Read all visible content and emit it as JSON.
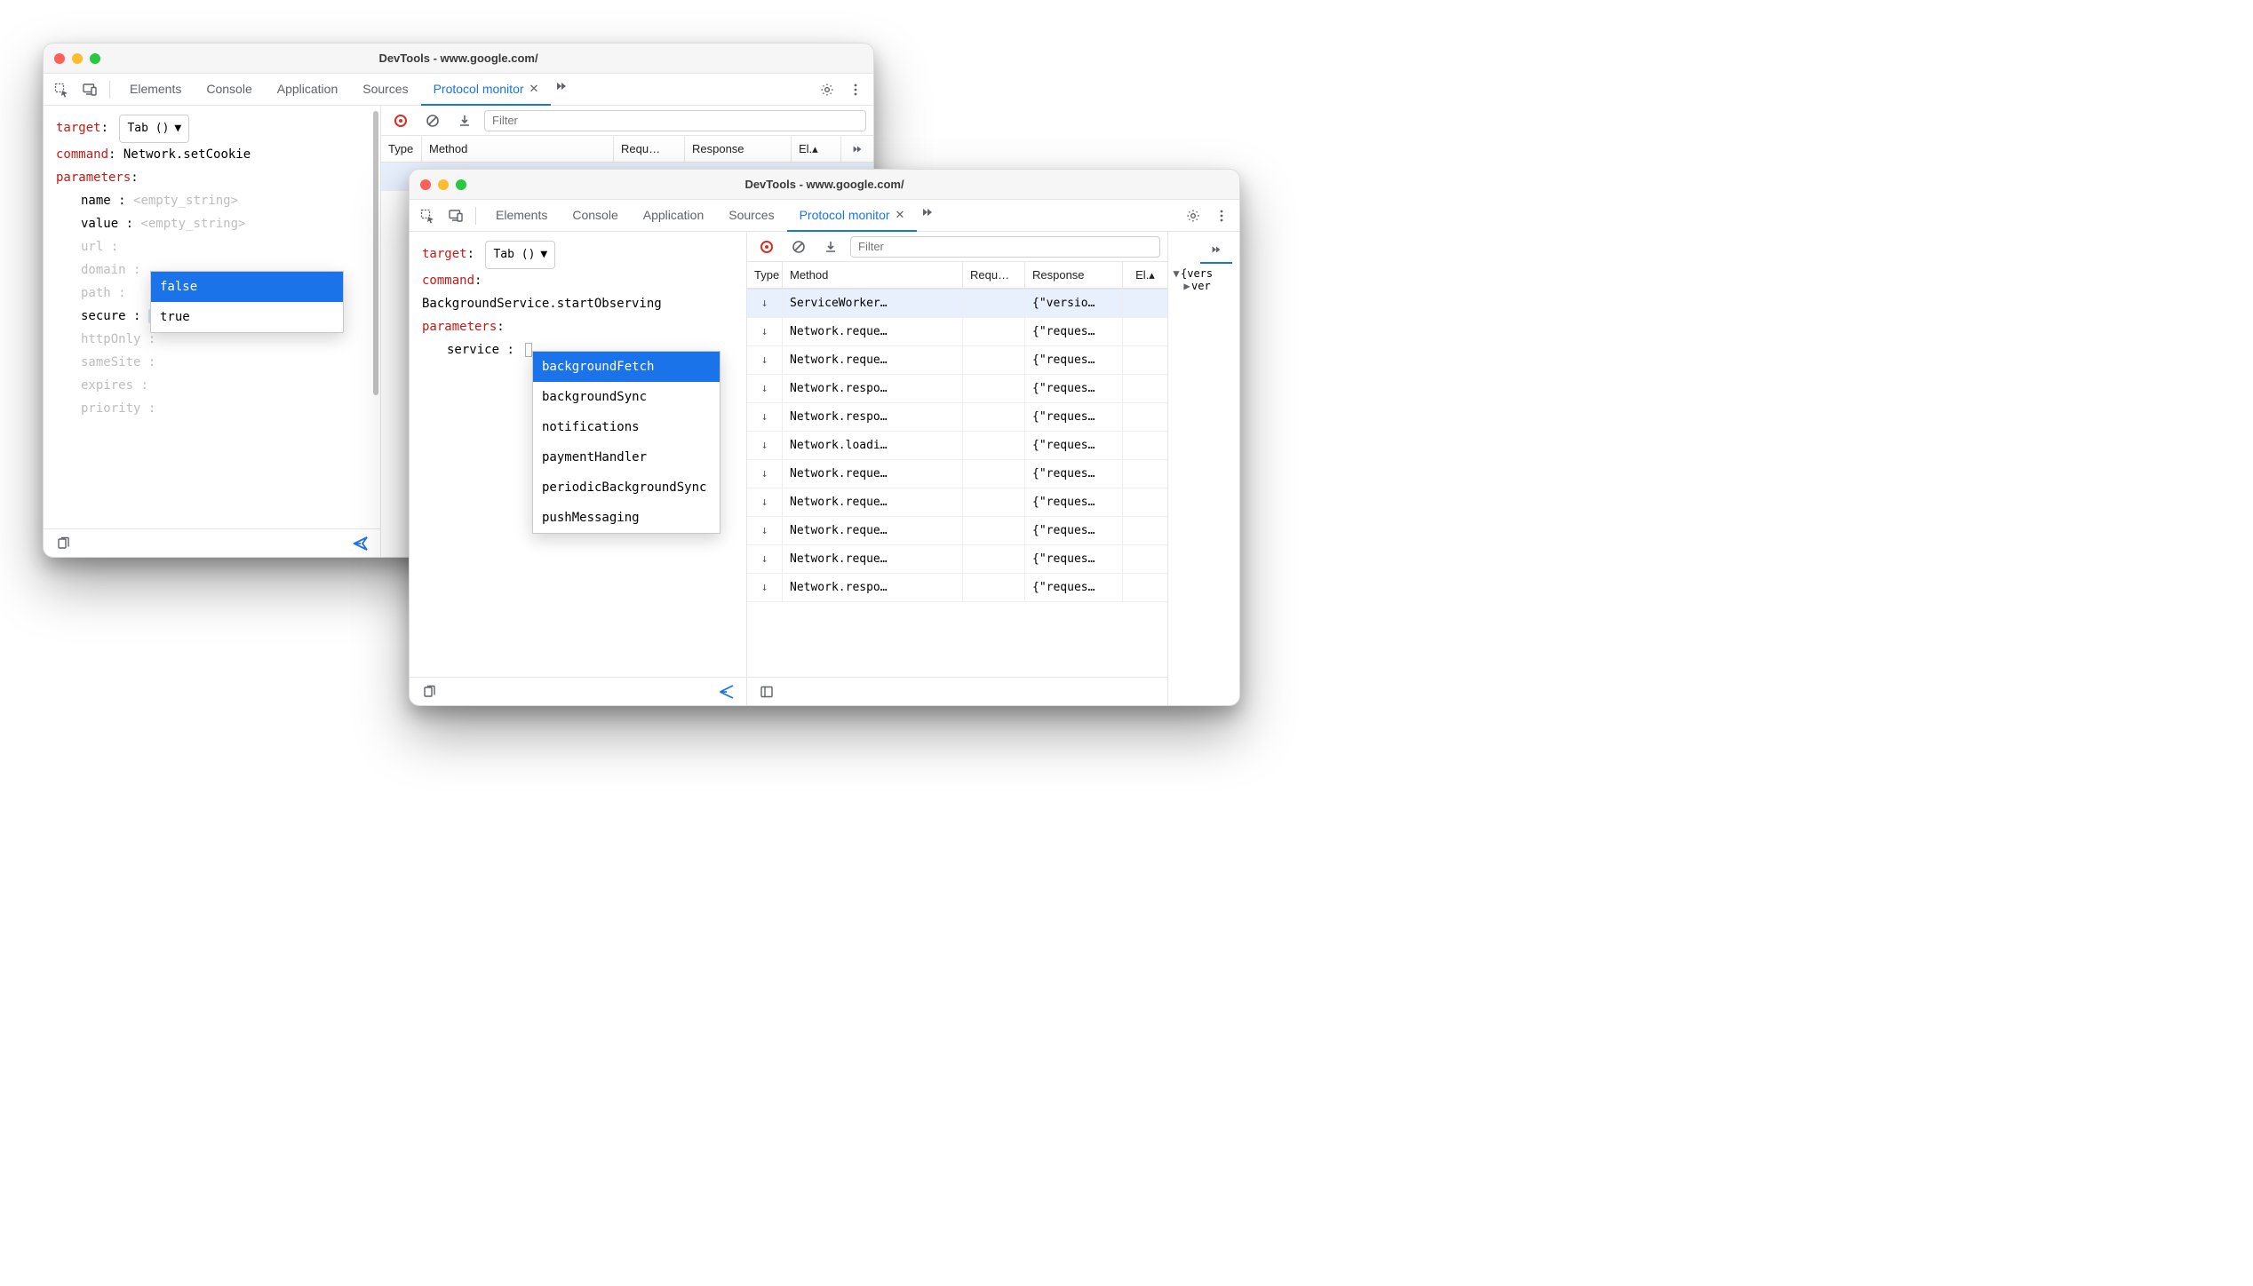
{
  "window1": {
    "title": "DevTools - www.google.com/",
    "tabs": [
      "Elements",
      "Console",
      "Application",
      "Sources",
      "Protocol monitor"
    ],
    "active_tab": "Protocol monitor",
    "editor": {
      "target_label": "target",
      "target_value": "Tab ()",
      "command_label": "command",
      "command_value": "Network.setCookie",
      "parameters_label": "parameters",
      "params": [
        {
          "name": "name",
          "value": "<empty_string>",
          "muted": false,
          "empty": true
        },
        {
          "name": "value",
          "value": "<empty_string>",
          "muted": false,
          "empty": true
        },
        {
          "name": "url",
          "value": "",
          "muted": true
        },
        {
          "name": "domain",
          "value": "",
          "muted": true
        },
        {
          "name": "path",
          "value": "",
          "muted": true
        },
        {
          "name": "secure",
          "value": "false",
          "muted": false,
          "highlight": true,
          "cancel": true
        },
        {
          "name": "httpOnly",
          "value": "",
          "muted": true
        },
        {
          "name": "sameSite",
          "value": "",
          "muted": true
        },
        {
          "name": "expires",
          "value": "",
          "muted": true
        },
        {
          "name": "priority",
          "value": "",
          "muted": true
        }
      ],
      "dropdown": {
        "options": [
          "false",
          "true"
        ],
        "selected": "false"
      }
    },
    "columns": [
      "Type",
      "Method",
      "Requ…",
      "Response",
      "El.▴"
    ],
    "filter_placeholder": "Filter"
  },
  "window2": {
    "title": "DevTools - www.google.com/",
    "tabs": [
      "Elements",
      "Console",
      "Application",
      "Sources",
      "Protocol monitor"
    ],
    "active_tab": "Protocol monitor",
    "editor": {
      "target_label": "target",
      "target_value": "Tab ()",
      "command_label": "command",
      "command_value": "BackgroundService.startObserving",
      "parameters_label": "parameters",
      "service_label": "service",
      "dropdown": {
        "options": [
          "backgroundFetch",
          "backgroundSync",
          "notifications",
          "paymentHandler",
          "periodicBackgroundSync",
          "pushMessaging"
        ],
        "selected": "backgroundFetch"
      }
    },
    "filter_placeholder": "Filter",
    "columns": [
      "Type",
      "Method",
      "Requ…",
      "Response",
      "El.▴"
    ],
    "rows": [
      {
        "dir": "down",
        "method": "ServiceWorker…",
        "req": "",
        "resp": "{\"versio…",
        "sel": true
      },
      {
        "dir": "down",
        "method": "Network.reque…",
        "req": "",
        "resp": "{\"reques…"
      },
      {
        "dir": "down",
        "method": "Network.reque…",
        "req": "",
        "resp": "{\"reques…"
      },
      {
        "dir": "down",
        "method": "Network.respo…",
        "req": "",
        "resp": "{\"reques…"
      },
      {
        "dir": "down",
        "method": "Network.respo…",
        "req": "",
        "resp": "{\"reques…"
      },
      {
        "dir": "down",
        "method": "Network.loadi…",
        "req": "",
        "resp": "{\"reques…"
      },
      {
        "dir": "down",
        "method": "Network.reque…",
        "req": "",
        "resp": "{\"reques…"
      },
      {
        "dir": "down",
        "method": "Network.reque…",
        "req": "",
        "resp": "{\"reques…"
      },
      {
        "dir": "down",
        "method": "Network.reque…",
        "req": "",
        "resp": "{\"reques…"
      },
      {
        "dir": "down",
        "method": "Network.reque…",
        "req": "",
        "resp": "{\"reques…"
      },
      {
        "dir": "down",
        "method": "Network.respo…",
        "req": "",
        "resp": "{\"reques…"
      }
    ],
    "detail": {
      "root": "{vers",
      "child": "ver"
    }
  }
}
